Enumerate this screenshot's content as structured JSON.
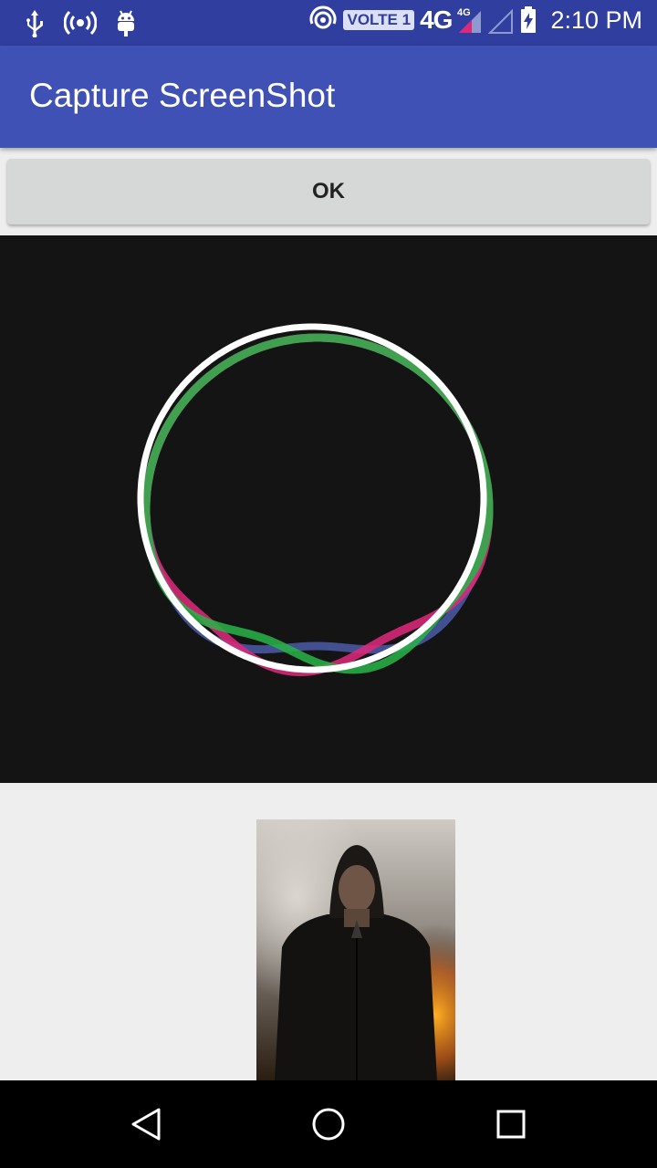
{
  "status_bar": {
    "left_icons": [
      "usb-icon",
      "hotspot-icon",
      "android-debug-icon"
    ],
    "right_icons": [
      "wifi-calling-icon",
      "volte-badge",
      "signal-4g-icon",
      "signal-empty-icon",
      "battery-charging-icon"
    ],
    "volte_label": "VOLTE 1",
    "network_label": "4G",
    "time": "2:10 PM"
  },
  "app_bar": {
    "title": "Capture ScreenShot"
  },
  "ok_button": {
    "label": "OK"
  },
  "animation": {
    "ring_colors": [
      "#ffffff",
      "#e0287a",
      "#28b446",
      "#4a5aa8"
    ]
  },
  "photo": {
    "icon": "hooded-man-poster-image"
  },
  "nav_bar": {
    "icons": [
      "back-icon",
      "home-icon",
      "recents-icon"
    ]
  },
  "colors": {
    "status_bar": "#303f9f",
    "app_bar": "#3f51b5",
    "background": "#eeeeee",
    "panel": "#141414"
  }
}
